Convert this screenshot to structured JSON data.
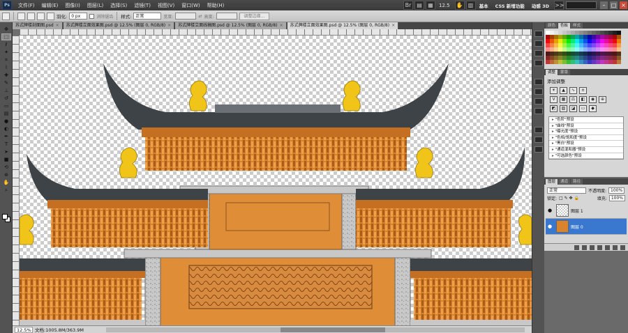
{
  "app": {
    "logo": "Ps"
  },
  "menu": [
    "文件(F)",
    "编辑(E)",
    "图像(I)",
    "图层(L)",
    "选择(S)",
    "滤镜(T)",
    "视图(V)",
    "窗口(W)",
    "帮助(H)"
  ],
  "topbar": {
    "zoom": "12.5",
    "workspaces": [
      "基本",
      "CSS 新增功能",
      "动感 3D"
    ],
    "expand": ">>"
  },
  "options": {
    "feather_label": "羽化:",
    "feather_value": "0 px",
    "antialias_label": "消除锯齿",
    "style_label": "样式:",
    "style_value": "正常",
    "width_label": "宽度:",
    "height_label": "高度:",
    "refine_button": "调整边缘..."
  },
  "tabs": [
    {
      "label": "苏式牌楼剖面图.psd",
      "active": false
    },
    {
      "label": "苏式牌楼立面效果图.psd @ 12.5% (图层 0, RGB/8)",
      "active": false
    },
    {
      "label": "苏式牌楼立面线稿图.psd @ 12.5% (图层 0, RGB/8)",
      "active": false
    },
    {
      "label": "苏式牌楼立面效果图.psd @ 12.5% (图层 0, RGB/8)",
      "active": true
    }
  ],
  "status": {
    "zoom": "12.5%",
    "doc": "文档:1005.8M/363.9M"
  },
  "panels": {
    "color_tabs": [
      "颜色",
      "色板",
      "样式"
    ],
    "adjust_tabs": [
      "调整",
      "蒙版"
    ],
    "adjust_title": "添加调整",
    "presets": [
      "\"色阶\"预设",
      "\"曲线\"预设",
      "\"曝光度\"预设",
      "\"色相/饱和度\"预设",
      "\"黑白\"预设",
      "\"通道混和器\"预设",
      "\"可选颜色\"预设"
    ],
    "layer_tabs": [
      "图层",
      "通道",
      "路径"
    ],
    "blend_mode": "正常",
    "opacity_label": "不透明度:",
    "opacity": "100%",
    "lock_label": "锁定:",
    "fill_label": "填充:",
    "fill": "100%",
    "layers": [
      {
        "name": "图层 1",
        "selected": false
      },
      {
        "name": "图层 0",
        "selected": true
      }
    ]
  },
  "colors": {
    "accent": "#3a78d0",
    "wall": "#e08d38",
    "roof": "#555a5e",
    "ornament": "#f0c419"
  }
}
